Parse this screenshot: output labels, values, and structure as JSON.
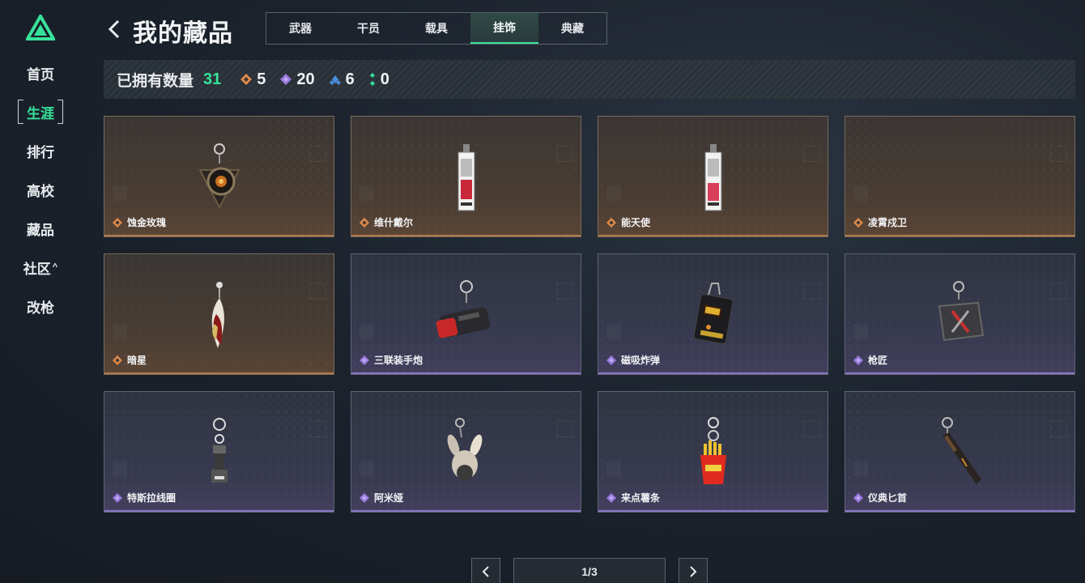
{
  "sidebar": {
    "items": [
      {
        "label": "首页",
        "active": false
      },
      {
        "label": "生涯",
        "active": true
      },
      {
        "label": "排行",
        "active": false
      },
      {
        "label": "高校",
        "active": false
      },
      {
        "label": "藏品",
        "active": false
      },
      {
        "label": "社区",
        "active": false,
        "caret": "^"
      },
      {
        "label": "改枪",
        "active": false
      }
    ]
  },
  "header": {
    "title": "我的藏品",
    "tabs": [
      {
        "label": "武器",
        "active": false
      },
      {
        "label": "干员",
        "active": false
      },
      {
        "label": "载具",
        "active": false
      },
      {
        "label": "挂饰",
        "active": true
      },
      {
        "label": "典藏",
        "active": false
      }
    ]
  },
  "stats": {
    "label": "已拥有数量",
    "total": "31",
    "tiers": [
      {
        "icon": "orange-diamond-icon",
        "color": "#e08a4a",
        "count": "5"
      },
      {
        "icon": "purple-diamond-icon",
        "color": "#9a7ae0",
        "count": "20"
      },
      {
        "icon": "blue-diamond-icon",
        "color": "#4a8ee0",
        "count": "6"
      },
      {
        "icon": "green-dots-icon",
        "color": "#37e29a",
        "count": "0"
      }
    ]
  },
  "items": [
    {
      "name": "蚀金玫瑰",
      "rarity": "orange",
      "icon": "rose-charm-icon"
    },
    {
      "name": "维什戴尔",
      "rarity": "orange",
      "icon": "card-tag-charm-icon"
    },
    {
      "name": "能天使",
      "rarity": "orange",
      "icon": "card-tag-charm-icon"
    },
    {
      "name": "凌霄戍卫",
      "rarity": "orange",
      "icon": ""
    },
    {
      "name": "暗星",
      "rarity": "orange",
      "icon": "feather-blade-charm-icon"
    },
    {
      "name": "三联装手炮",
      "rarity": "purple",
      "icon": "hand-cannon-charm-icon"
    },
    {
      "name": "磁吸炸弹",
      "rarity": "purple",
      "icon": "bomb-charm-icon"
    },
    {
      "name": "枪匠",
      "rarity": "purple",
      "icon": "gunsmith-charm-icon"
    },
    {
      "name": "特斯拉线圈",
      "rarity": "purple",
      "icon": "tesla-coil-charm-icon"
    },
    {
      "name": "阿米娅",
      "rarity": "purple",
      "icon": "bunny-charm-icon"
    },
    {
      "name": "来点薯条",
      "rarity": "purple",
      "icon": "fries-charm-icon"
    },
    {
      "name": "仪典匕首",
      "rarity": "purple",
      "icon": "dagger-charm-icon"
    }
  ],
  "pagination": {
    "label": "1/3"
  },
  "colors": {
    "accent": "#37e29a",
    "orange_tier": "#e08a4a",
    "purple_tier": "#9a7ae0"
  }
}
